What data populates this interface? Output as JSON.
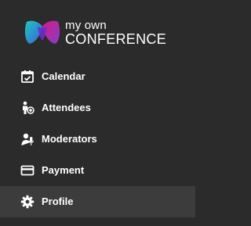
{
  "brand": {
    "line1": "my own",
    "line2": "CONFERENCE",
    "colors": {
      "magenta": "#e0198a",
      "teal": "#1fc7c1",
      "blue": "#3a5fd9",
      "purple": "#8a3fd1"
    }
  },
  "sidebar": {
    "background": "#2b2b2b",
    "active_background": "#3c3c3c",
    "items": [
      {
        "label": "Calendar",
        "icon": "calendar-check-icon"
      },
      {
        "label": "Attendees",
        "icon": "person-add-icon"
      },
      {
        "label": "Moderators",
        "icon": "person-microphone-icon"
      },
      {
        "label": "Payment",
        "icon": "credit-card-icon"
      },
      {
        "label": "Profile",
        "icon": "gear-icon",
        "active": true
      }
    ]
  }
}
